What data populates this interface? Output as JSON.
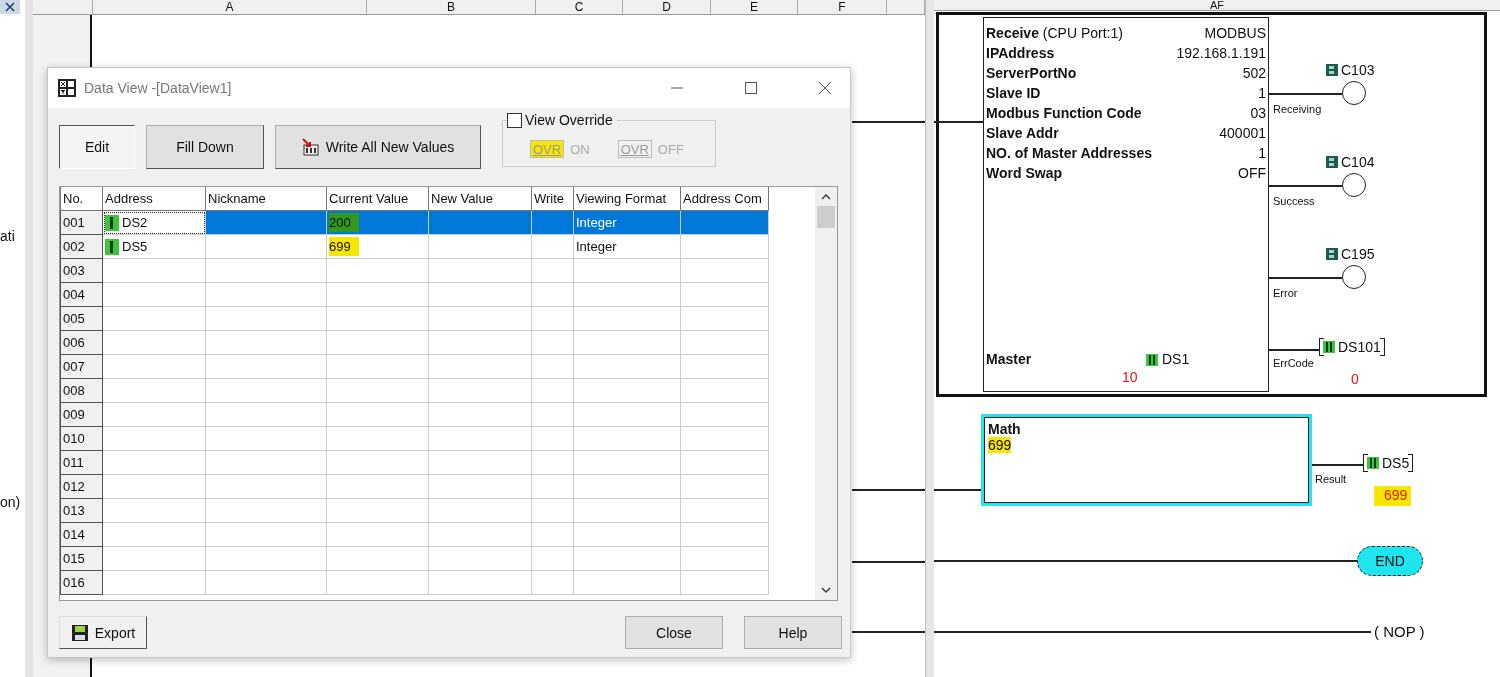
{
  "left_panel": {
    "texts": [
      "ati",
      "on)"
    ]
  },
  "sheet": {
    "columns": [
      "A",
      "B",
      "C",
      "D",
      "E",
      "F"
    ]
  },
  "dialog": {
    "title": "Data View -[DataView1]",
    "toolbar": [
      {
        "label": "Edit",
        "pressed": true,
        "kind": "plain"
      },
      {
        "label": "Fill Down",
        "pressed": false,
        "kind": "plain"
      },
      {
        "label": "Write All New Values",
        "pressed": false,
        "kind": "write"
      }
    ],
    "view_override": {
      "label": "View Override",
      "checked": false,
      "options": [
        {
          "button": "OVR",
          "label": "ON",
          "highlighted": true
        },
        {
          "button": "OVR",
          "label": "OFF",
          "highlighted": false
        }
      ]
    },
    "table": {
      "columns": [
        "No.",
        "Address",
        "Nickname",
        "Current Value",
        "New Value",
        "Write",
        "Viewing Format",
        "Address Com"
      ],
      "rows": [
        {
          "no": "001",
          "address": "DS2",
          "current_value": "200",
          "viewing_format": "Integer",
          "selected": true,
          "highlighted": true
        },
        {
          "no": "002",
          "address": "DS5",
          "current_value": "699",
          "viewing_format": "Integer",
          "selected": false,
          "highlighted": true
        },
        {
          "no": "003",
          "selected": false
        },
        {
          "no": "004",
          "selected": false
        },
        {
          "no": "005",
          "selected": false
        },
        {
          "no": "006",
          "selected": false
        },
        {
          "no": "007",
          "selected": false
        },
        {
          "no": "008",
          "selected": false
        },
        {
          "no": "009",
          "selected": false
        },
        {
          "no": "010",
          "selected": false
        },
        {
          "no": "011",
          "selected": false
        },
        {
          "no": "012",
          "selected": false
        },
        {
          "no": "013",
          "selected": false
        },
        {
          "no": "014",
          "selected": false
        },
        {
          "no": "015",
          "selected": false
        },
        {
          "no": "016",
          "selected": false
        }
      ]
    },
    "buttons": [
      {
        "label": "Export",
        "kind": "export"
      },
      {
        "label": "Close",
        "kind": "plain"
      },
      {
        "label": "Help",
        "kind": "plain"
      }
    ]
  },
  "ladder": {
    "header": "AF",
    "receive": {
      "title": "**Receive** (CPU Port:1)",
      "protocol": "MODBUS",
      "params": [
        {
          "label": "IPAddress",
          "value": "192.168.1.191"
        },
        {
          "label": "ServerPortNo",
          "value": "502"
        },
        {
          "label": "Slave ID",
          "value": "1"
        },
        {
          "label": "Modbus Function Code",
          "value": "03"
        },
        {
          "label": "Slave Addr",
          "value": "400001"
        },
        {
          "label": "NO. of Master Addresses",
          "value": "1"
        },
        {
          "label": "Word Swap",
          "value": "OFF"
        }
      ],
      "master": {
        "label": "Master",
        "address": "DS1",
        "value": "10"
      }
    },
    "outputs": [
      {
        "kind": "coil",
        "address": "C103",
        "label": "Receiving"
      },
      {
        "kind": "coil",
        "address": "C104",
        "label": "Success"
      },
      {
        "kind": "coil",
        "address": "C195",
        "label": "Error"
      },
      {
        "kind": "register",
        "address": "DS101",
        "label": "ErrCode",
        "value": "0"
      }
    ],
    "math": {
      "title": "Math",
      "expression": "699",
      "highlighted": true,
      "output": {
        "address": "DS5",
        "label": "Result",
        "value": "699",
        "highlighted": true
      }
    },
    "end": "END",
    "nop": "( NOP )"
  }
}
